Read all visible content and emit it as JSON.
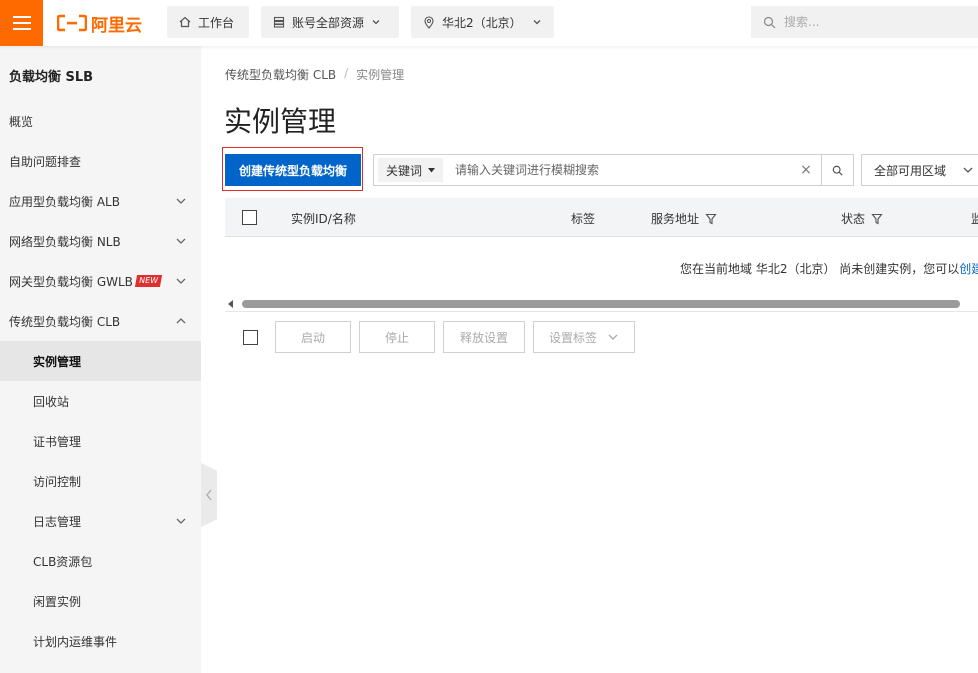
{
  "topbar": {
    "logo_text": "阿里云",
    "workbench_label": "工作台",
    "resources_label": "账号全部资源",
    "region_label": "华北2（北京）",
    "search_placeholder": "搜索..."
  },
  "sidebar": {
    "title": "负载均衡 SLB",
    "items": [
      {
        "label": "概览"
      },
      {
        "label": "自助问题排查"
      },
      {
        "label": "应用型负载均衡 ALB"
      },
      {
        "label": "网络型负载均衡 NLB"
      },
      {
        "label": "网关型负载均衡 GWLB",
        "badge": "NEW"
      },
      {
        "label": "传统型负载均衡 CLB"
      },
      {
        "label": "实例管理"
      },
      {
        "label": "回收站"
      },
      {
        "label": "证书管理"
      },
      {
        "label": "访问控制"
      },
      {
        "label": "日志管理"
      },
      {
        "label": "CLB资源包"
      },
      {
        "label": "闲置实例"
      },
      {
        "label": "计划内运维事件"
      }
    ]
  },
  "breadcrumb": {
    "parent": "传统型负载均衡 CLB",
    "separator": "/",
    "current": "实例管理"
  },
  "page": {
    "title": "实例管理",
    "create_button": "创建传统型负载均衡",
    "keyword_select": "关键词",
    "search_placeholder": "请输入关键词进行模糊搜索",
    "clear_symbol": "×",
    "region_filter": "全部可用区域"
  },
  "table": {
    "columns": [
      "实例ID/名称",
      "标签",
      "服务地址",
      "状态",
      "监"
    ]
  },
  "empty": {
    "message": "您在当前地域 华北2（北京） 尚未创建实例，您可以",
    "link": "创建"
  },
  "actions": {
    "start": "启动",
    "stop": "停止",
    "release": "释放设置",
    "set_tags": "设置标签"
  },
  "colors": {
    "brand": "#ff6a00",
    "primary": "#0064c8",
    "highlight": "#e22d2d"
  }
}
